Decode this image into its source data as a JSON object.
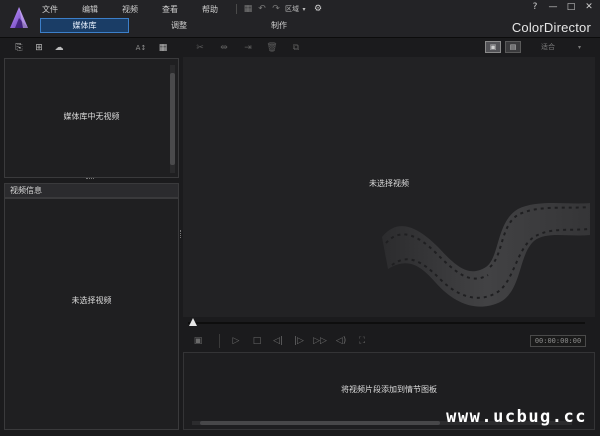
{
  "menu": {
    "items": [
      "文件",
      "编辑",
      "视频",
      "查看",
      "帮助"
    ],
    "zoom_label": "区域"
  },
  "window": {
    "help": "?",
    "minimize": "—",
    "maximize": "□",
    "close": "✕",
    "brand": "ColorDirector"
  },
  "tabs": [
    {
      "label": "媒体库",
      "active": true
    },
    {
      "label": "调整",
      "active": false
    },
    {
      "label": "制作",
      "active": false
    }
  ],
  "library": {
    "empty_message": "媒体库中无视频",
    "font_size_label": "A↕"
  },
  "video_info": {
    "header": "视频信息",
    "empty_message": "未选择视频"
  },
  "preview": {
    "empty_message": "未选择视频",
    "fit_label": "适合",
    "progress": 0
  },
  "playback": {
    "timecode": "00:00:00:00"
  },
  "storyboard": {
    "hint": "将视频片段添加到情节图板"
  },
  "watermark": "www.ucbug.cc",
  "colors": {
    "accent": "#3c7fc9",
    "background": "#1b1b1d"
  }
}
